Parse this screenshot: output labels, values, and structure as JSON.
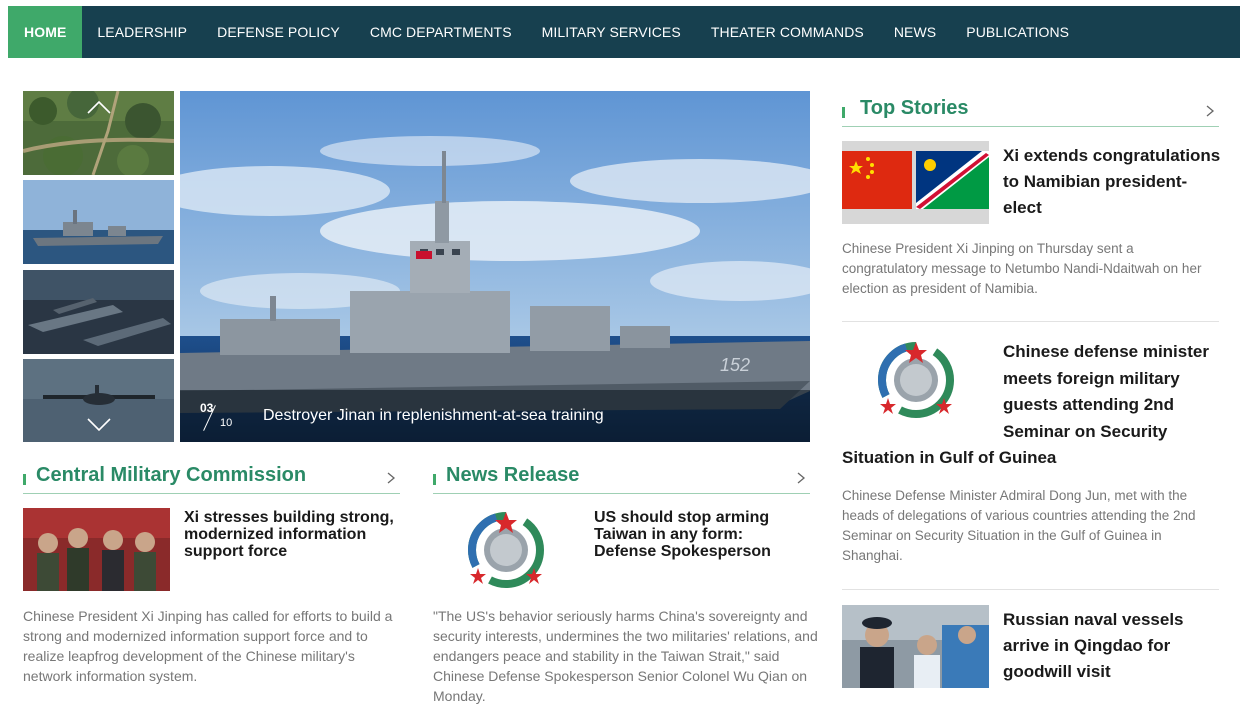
{
  "nav": {
    "items": [
      {
        "label": "HOME",
        "active": true
      },
      {
        "label": "LEADERSHIP"
      },
      {
        "label": "DEFENSE POLICY"
      },
      {
        "label": "CMC DEPARTMENTS"
      },
      {
        "label": "MILITARY SERVICES"
      },
      {
        "label": "THEATER COMMANDS"
      },
      {
        "label": "NEWS"
      },
      {
        "label": "PUBLICATIONS"
      }
    ]
  },
  "slider": {
    "current": "03",
    "total": "10",
    "caption": "Destroyer Jinan in replenishment-at-sea training",
    "ship_number": "152",
    "icons": {
      "up": "chevron-up-icon",
      "down": "chevron-down-icon"
    }
  },
  "cmc": {
    "heading": "Central Military Commission",
    "story": {
      "title": "Xi stresses building strong, modernized information support force",
      "desc": "Chinese President Xi Jinping has called for efforts to build a strong and modernized information support force and to realize leapfrog development of the Chinese military's network information system."
    }
  },
  "news_release": {
    "heading": "News Release",
    "story": {
      "title": "US should stop arming Taiwan in any form: Defense Spokesperson",
      "desc": "\"The US's behavior seriously harms China's sovereignty and security interests, undermines the two militaries' relations, and endangers peace and stability in the Taiwan Strait,\" said Chinese Defense Spokesperson Senior Colonel Wu Qian on Monday."
    }
  },
  "top_stories": {
    "heading": "Top Stories",
    "stories": [
      {
        "title": "Xi extends congratulations to Namibian president-elect",
        "desc": "Chinese President Xi Jinping on Thursday sent a congratulatory message to Netumbo Nandi-Ndaitwah on her election as president of Namibia."
      },
      {
        "title_lines": [
          "Chinese defense minister",
          "meets foreign military",
          "guests attending 2nd",
          "Seminar on Security",
          "Situation in Gulf of Guinea"
        ],
        "desc": "Chinese Defense Minister Admiral Dong Jun, met with the heads of delegations of various countries attending the 2nd Seminar on Security Situation in the Gulf of Guinea in Shanghai."
      },
      {
        "title": "Russian naval vessels arrive in Qingdao for goodwill visit"
      }
    ]
  },
  "colors": {
    "nav_bg": "#17404f",
    "accent_green": "#3fa96a",
    "heading_green": "#2a8a66"
  }
}
